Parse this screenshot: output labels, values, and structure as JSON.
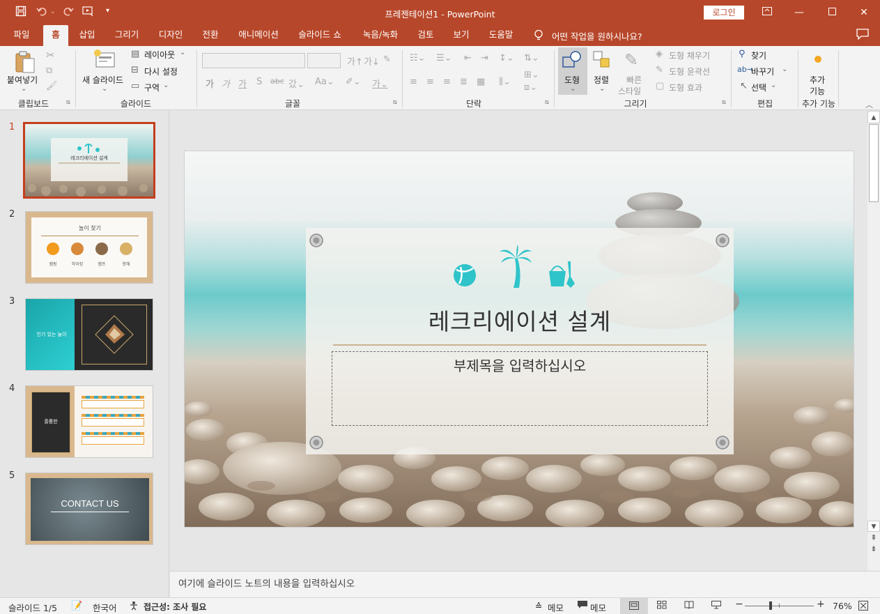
{
  "titlebar": {
    "document_name": "프레젠테이션1",
    "separator": " - ",
    "app_name": "PowerPoint",
    "login_label": "로그인",
    "quick_access": [
      "save-icon",
      "undo-icon",
      "redo-icon",
      "present-from-start-icon",
      "customize-qat-icon"
    ]
  },
  "tabs": [
    {
      "label": "파일"
    },
    {
      "label": "홈"
    },
    {
      "label": "삽입"
    },
    {
      "label": "그리기"
    },
    {
      "label": "디자인"
    },
    {
      "label": "전환"
    },
    {
      "label": "애니메이션"
    },
    {
      "label": "슬라이드 쇼"
    },
    {
      "label": "녹음/녹화"
    },
    {
      "label": "검토"
    },
    {
      "label": "보기"
    },
    {
      "label": "도움말"
    }
  ],
  "tell_me": "어떤 작업을 원하시나요?",
  "ribbon": {
    "clipboard": {
      "paste": "붙여넣기",
      "group": "클립보드"
    },
    "slides": {
      "new_slide": "새 슬라이드",
      "layout": "레이아웃",
      "reset": "다시 설정",
      "section": "구역",
      "group": "슬라이드"
    },
    "font": {
      "group": "글꼴"
    },
    "paragraph": {
      "group": "단락"
    },
    "drawing": {
      "shapes": "도형",
      "arrange": "정렬",
      "quick_styles_1": "빠른",
      "quick_styles_2": "스타일",
      "shape_fill": "도형 채우기",
      "shape_outline": "도형 윤곽선",
      "shape_effects": "도형 효과",
      "group": "그리기"
    },
    "editing": {
      "find": "찾기",
      "replace": "바꾸기",
      "select": "선택",
      "group": "편집"
    },
    "addins": {
      "label_1": "추가",
      "label_2": "기능",
      "group": "추가 기능"
    }
  },
  "slides_panel": {
    "numbers": [
      "1",
      "2",
      "3",
      "4",
      "5"
    ],
    "slide2": {
      "title": "놀이 찾기",
      "items": [
        "캠핑",
        "하이킹",
        "캠프",
        "항해"
      ]
    },
    "slide3": {
      "title": "인기 있는 놀이"
    },
    "slide4": {
      "title": "흘륭한"
    },
    "slide5": {
      "title": "CONTACT US"
    }
  },
  "slide": {
    "title": "레크리에이션 설계",
    "subtitle": "부제목을 입력하십시오"
  },
  "notes_placeholder": "여기에 슬라이드 노트의 내용을 입력하십시오",
  "status": {
    "slide_counter": "슬라이드 1/5",
    "language": "한국어",
    "accessibility": "접근성: 조사 필요",
    "notes": "메모",
    "comments": "메모",
    "zoom_minus": "−",
    "zoom_plus": "+",
    "zoom": "76%"
  },
  "colors": {
    "accent": "#b7472a",
    "selection": "#c43e1c",
    "teal": "#2ec4c9"
  }
}
